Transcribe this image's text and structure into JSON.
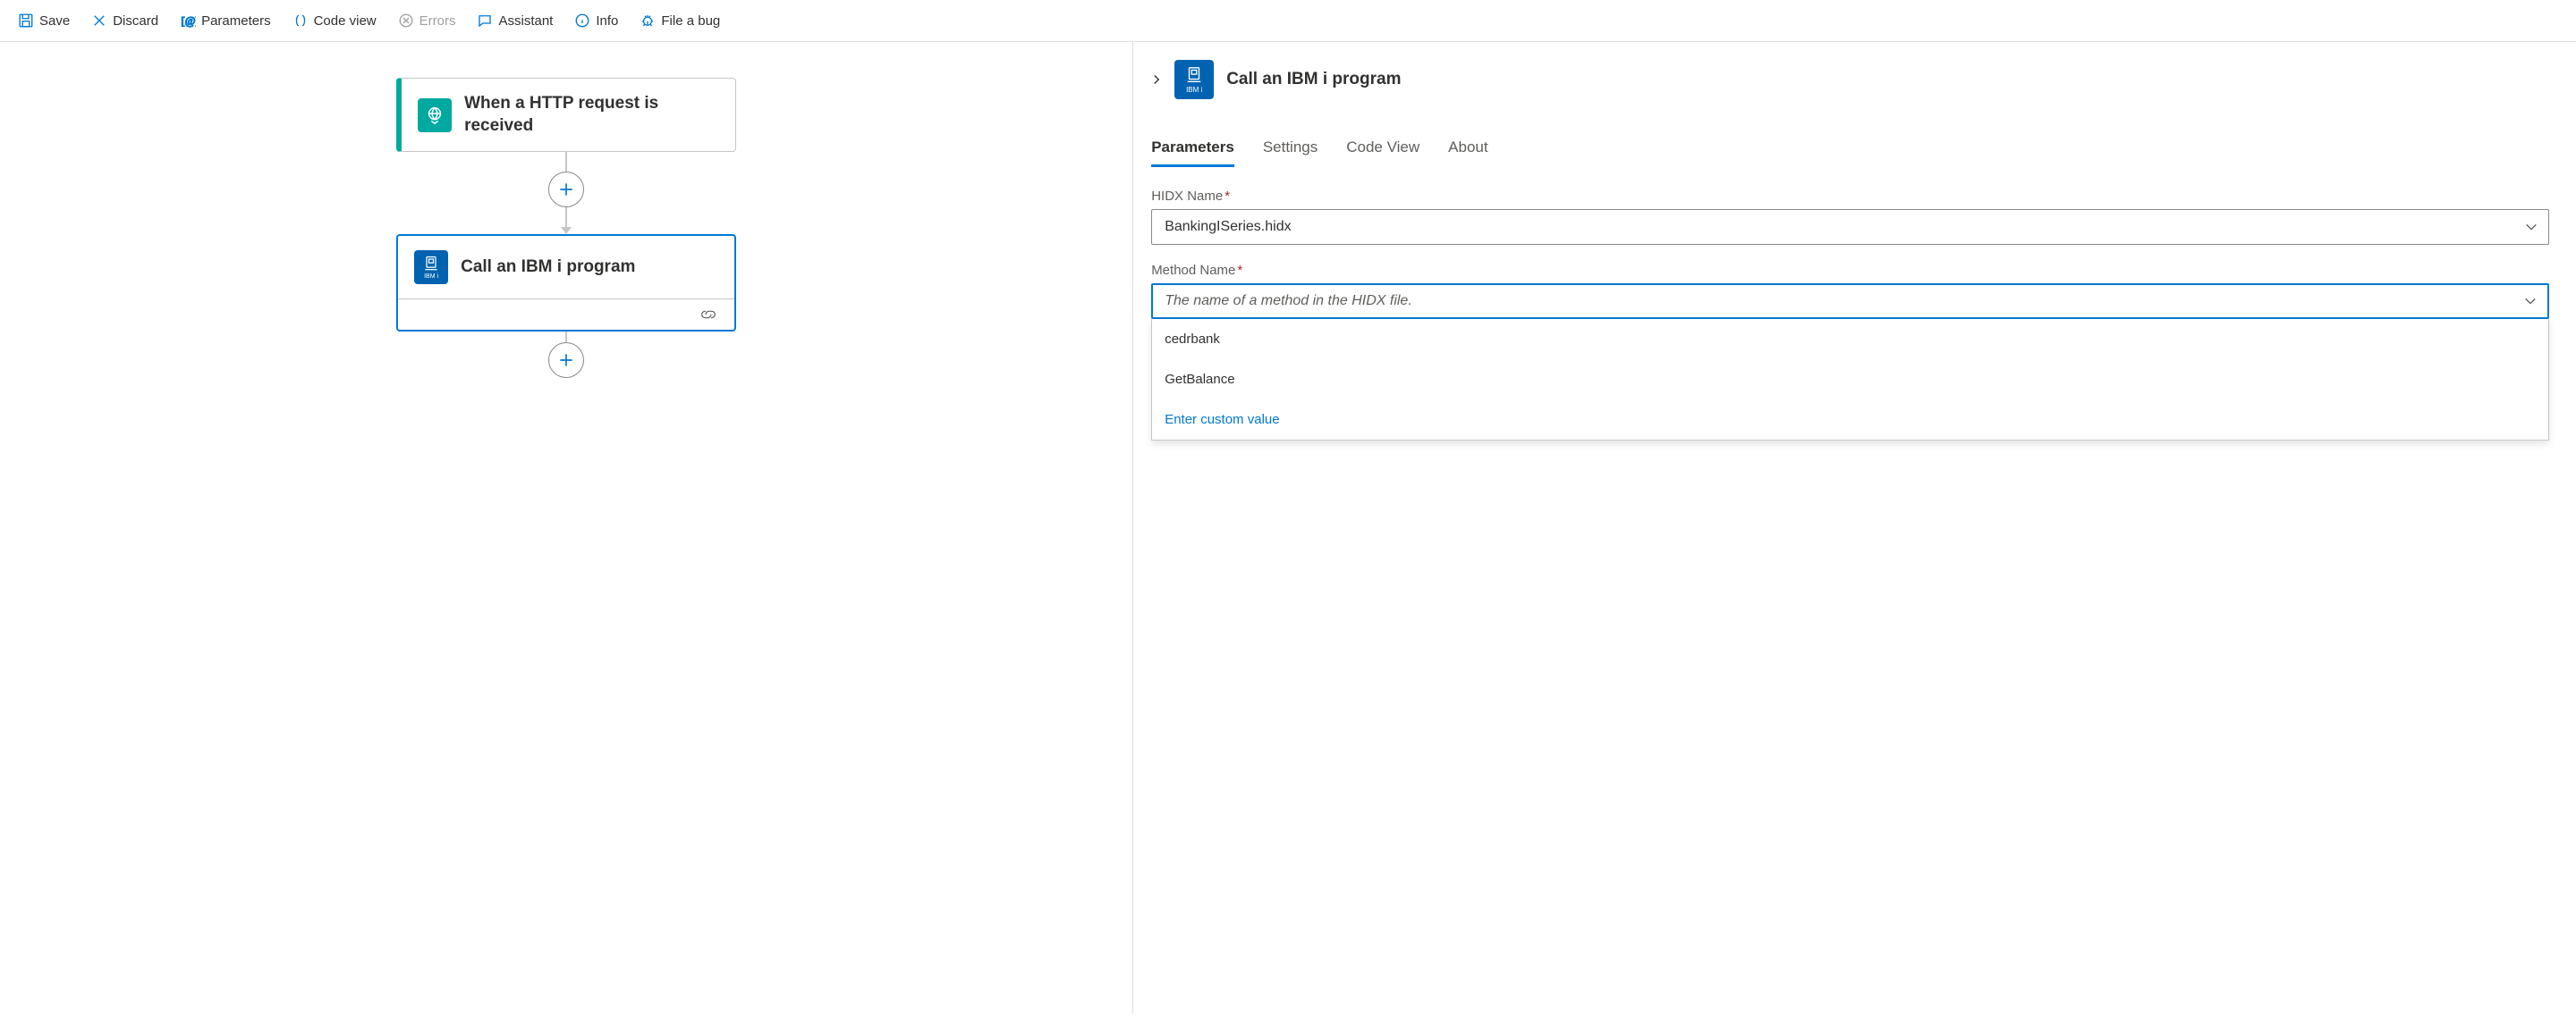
{
  "toolbar": {
    "save": "Save",
    "discard": "Discard",
    "parameters": "Parameters",
    "codeview": "Code view",
    "errors": "Errors",
    "assistant": "Assistant",
    "info": "Info",
    "filebug": "File a bug"
  },
  "flow": {
    "trigger": {
      "title": "When a HTTP request is received"
    },
    "action": {
      "title": "Call an IBM i program",
      "iconLabel": "IBM i"
    }
  },
  "panel": {
    "title": "Call an IBM i program",
    "iconLabel": "IBM i",
    "tabs": {
      "parameters": "Parameters",
      "settings": "Settings",
      "codeview": "Code View",
      "about": "About"
    },
    "form": {
      "hidx": {
        "label": "HIDX Name",
        "value": "BankingISeries.hidx"
      },
      "method": {
        "label": "Method Name",
        "placeholder": "The name of a method in the HIDX file.",
        "options": {
          "opt1": "cedrbank",
          "opt2": "GetBalance",
          "custom": "Enter custom value"
        }
      }
    }
  }
}
